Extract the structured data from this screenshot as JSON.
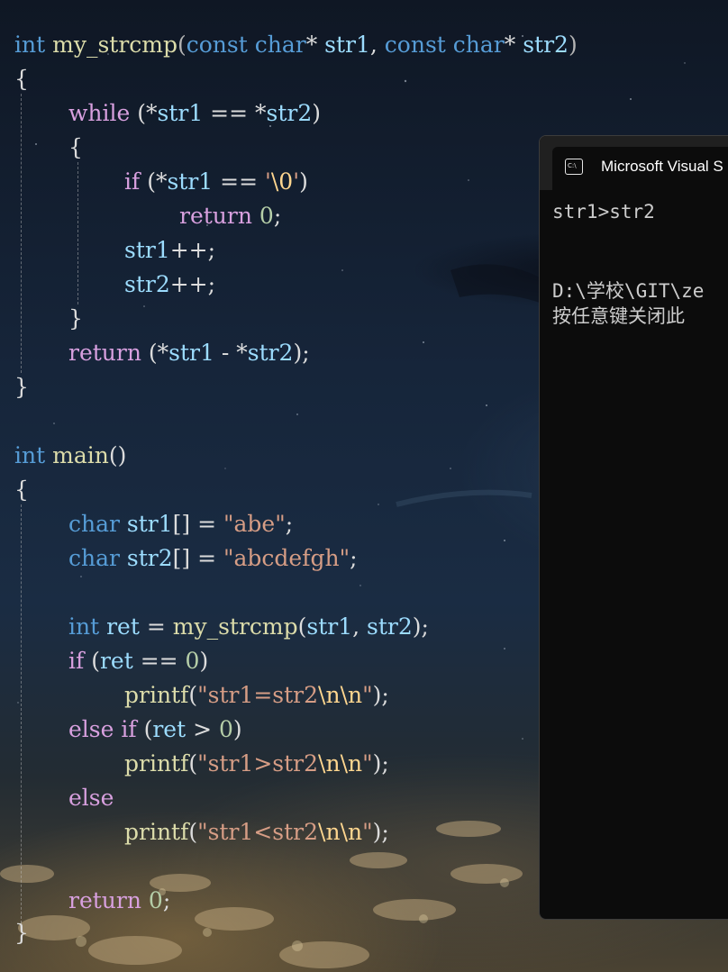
{
  "editor": {
    "language": "C",
    "lines": [
      "int my_strcmp(const char* str1, const char* str2)",
      "{",
      "while (*str1 == *str2)",
      "{",
      "if (*str1 == '\\0')",
      "return 0;",
      "str1++;",
      "str2++;",
      "}",
      "return (*str1 - *str2);",
      "}",
      "",
      "int main()",
      "{",
      "char str1[] = \"abe\";",
      "char str2[] = \"abcdefgh\";",
      "",
      "int ret = my_strcmp(str1, str2);",
      "if (ret == 0)",
      "printf(\"str1=str2\\n\\n\");",
      "else if (ret > 0)",
      "printf(\"str1>str2\\n\\n\");",
      "else",
      "printf(\"str1<str2\\n\\n\");",
      "",
      "return 0;",
      "}"
    ]
  },
  "console": {
    "title": "Microsoft Visual S",
    "icon": "terminal-icon",
    "output_line_1": "str1>str2",
    "output_line_2": "D:\\学校\\GIT\\ze",
    "output_line_3": "按任意键关闭此"
  },
  "colors": {
    "keyword": "#569cd6",
    "function": "#dcdcaa",
    "control": "#d8a0df",
    "variable": "#9cdcfe",
    "string": "#d69d85",
    "number": "#b5cea8",
    "console_bg": "#0c0c0c"
  }
}
